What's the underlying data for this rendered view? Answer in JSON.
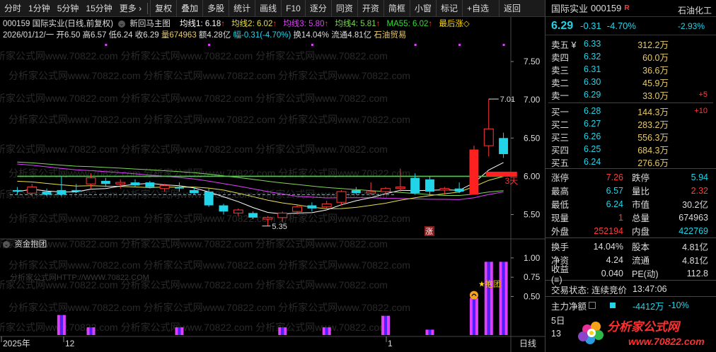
{
  "toolbar": {
    "left_items": [
      "分时",
      "1分钟",
      "5分钟",
      "15分钟",
      "更多 ›"
    ],
    "buttons": [
      "复权",
      "叠加",
      "多股",
      "统计",
      "画线",
      "F10",
      "逐分",
      "同资",
      "开资",
      "简框",
      "小窗",
      "标记",
      "+自选",
      "返回"
    ]
  },
  "chart": {
    "title": "000159 国际实业(日线,前复权)",
    "indicator_name": "新回马主图",
    "ma1_label": "均线1: 6.18",
    "ma2_label": "均线2: 6.02",
    "ma3_label": "均线3: 5.80",
    "ma4_label": "均线4: 5.81",
    "ma55_label": "MA55: 6.02",
    "last_label": "最后涨◇",
    "date_line": "2026/01/12/一",
    "open": "开6.50",
    "high": "高6.57",
    "low": "低6.24",
    "close": "收6.29",
    "vol": "量674963",
    "amount": "额4.28亿",
    "range": "幅-0.31(-4.70%)",
    "turnover": "换14.04%",
    "float": "流通4.81亿",
    "sector": "石油贸易",
    "high_mark": "7.01",
    "low_mark": "5.35",
    "days_mark": "3天",
    "zhang_mark": "涨",
    "sub_title": "资金抱团",
    "baotuan": "★抱团",
    "watermark": "分析家公式网www.70822.com",
    "watermark2": "分析家公式网HTTP://WWW.70822.COM",
    "x_labels": [
      "2025年",
      "12",
      "1"
    ],
    "x_end": "日线"
  },
  "chart_data": [
    {
      "type": "candlestick",
      "y_ticks": [
        5.5,
        6.0,
        6.5,
        7.0,
        7.5
      ],
      "ylim": [
        5.2,
        7.75
      ],
      "candles": [
        {
          "o": 5.82,
          "h": 5.86,
          "l": 5.76,
          "c": 5.8
        },
        {
          "o": 5.78,
          "h": 5.9,
          "l": 5.74,
          "c": 5.86
        },
        {
          "o": 5.8,
          "h": 5.84,
          "l": 5.74,
          "c": 5.76
        },
        {
          "o": 5.82,
          "h": 6.0,
          "l": 5.74,
          "c": 5.76
        },
        {
          "o": 5.82,
          "h": 5.9,
          "l": 5.78,
          "c": 5.8
        },
        {
          "o": 5.9,
          "h": 6.04,
          "l": 5.84,
          "c": 5.98
        },
        {
          "o": 5.94,
          "h": 5.98,
          "l": 5.86,
          "c": 5.9
        },
        {
          "o": 5.9,
          "h": 5.96,
          "l": 5.84,
          "c": 5.92
        },
        {
          "o": 5.92,
          "h": 5.96,
          "l": 5.86,
          "c": 5.88
        },
        {
          "o": 5.92,
          "h": 5.94,
          "l": 5.84,
          "c": 5.86
        },
        {
          "o": 5.84,
          "h": 5.9,
          "l": 5.8,
          "c": 5.88
        },
        {
          "o": 5.86,
          "h": 5.92,
          "l": 5.8,
          "c": 5.84
        },
        {
          "o": 5.82,
          "h": 5.86,
          "l": 5.76,
          "c": 5.78
        },
        {
          "o": 5.8,
          "h": 5.84,
          "l": 5.6,
          "c": 5.62
        },
        {
          "o": 5.62,
          "h": 5.64,
          "l": 5.5,
          "c": 5.54
        },
        {
          "o": 5.52,
          "h": 5.58,
          "l": 5.48,
          "c": 5.56
        },
        {
          "o": 5.52,
          "h": 5.54,
          "l": 5.44,
          "c": 5.46
        },
        {
          "o": 5.44,
          "h": 5.48,
          "l": 5.35,
          "c": 5.46
        },
        {
          "o": 5.46,
          "h": 5.54,
          "l": 5.4,
          "c": 5.52
        },
        {
          "o": 5.54,
          "h": 5.62,
          "l": 5.5,
          "c": 5.6
        },
        {
          "o": 5.62,
          "h": 5.66,
          "l": 5.54,
          "c": 5.58
        },
        {
          "o": 5.6,
          "h": 5.68,
          "l": 5.56,
          "c": 5.64
        },
        {
          "o": 5.66,
          "h": 5.82,
          "l": 5.62,
          "c": 5.8
        },
        {
          "o": 5.82,
          "h": 5.86,
          "l": 5.76,
          "c": 5.78
        },
        {
          "o": 5.78,
          "h": 5.92,
          "l": 5.76,
          "c": 5.8
        },
        {
          "o": 5.8,
          "h": 5.86,
          "l": 5.76,
          "c": 5.84
        },
        {
          "o": 5.84,
          "h": 6.1,
          "l": 5.8,
          "c": 5.86
        },
        {
          "o": 5.98,
          "h": 6.04,
          "l": 5.76,
          "c": 5.78
        },
        {
          "o": 5.96,
          "h": 6.0,
          "l": 5.74,
          "c": 5.8
        },
        {
          "o": 5.82,
          "h": 5.86,
          "l": 5.76,
          "c": 5.84
        },
        {
          "o": 5.84,
          "h": 5.92,
          "l": 5.78,
          "c": 5.8
        },
        {
          "o": 5.76,
          "h": 6.4,
          "l": 5.76,
          "c": 6.35
        },
        {
          "o": 6.4,
          "h": 7.01,
          "l": 6.26,
          "c": 6.62
        },
        {
          "o": 6.5,
          "h": 6.57,
          "l": 6.24,
          "c": 6.29
        }
      ]
    },
    {
      "type": "bar",
      "name": "资金抱团",
      "y_ticks": [
        0.5,
        0.75,
        1.0
      ],
      "ylim": [
        0,
        1.1
      ],
      "bars": [
        {
          "i": 3,
          "v": 0.26
        },
        {
          "i": 5,
          "v": 0.1
        },
        {
          "i": 11,
          "v": 0.1
        },
        {
          "i": 18,
          "v": 0.1
        },
        {
          "i": 21,
          "v": 0.1
        },
        {
          "i": 25,
          "v": 0.25
        },
        {
          "i": 28,
          "v": 0.07
        },
        {
          "i": 31,
          "v": 0.48
        },
        {
          "i": 32,
          "v": 0.95
        },
        {
          "i": 33,
          "v": 0.95
        }
      ]
    }
  ],
  "panel": {
    "name": "国际实业",
    "code": "000159",
    "r_tag": "R",
    "sector": "石油化工",
    "price": "6.29",
    "change": "-0.31",
    "pct": "-4.70%",
    "sector_pct": "-2.93%",
    "asks": [
      {
        "label": "卖五 ¥",
        "price": "6.33",
        "vol": "312.2万",
        "delta": ""
      },
      {
        "label": "卖四",
        "price": "6.32",
        "vol": "60.0万",
        "delta": ""
      },
      {
        "label": "卖三",
        "price": "6.31",
        "vol": "36.6万",
        "delta": ""
      },
      {
        "label": "卖二",
        "price": "6.30",
        "vol": "45.9万",
        "delta": ""
      },
      {
        "label": "卖一",
        "price": "6.29",
        "vol": "33.0万",
        "delta": "+5"
      }
    ],
    "bids": [
      {
        "label": "买一",
        "price": "6.28",
        "vol": "144.3万",
        "delta": "+10"
      },
      {
        "label": "买二",
        "price": "6.27",
        "vol": "283.2万",
        "delta": ""
      },
      {
        "label": "买三",
        "price": "6.26",
        "vol": "556.3万",
        "delta": ""
      },
      {
        "label": "买四",
        "price": "6.25",
        "vol": "684.3万",
        "delta": ""
      },
      {
        "label": "买五",
        "price": "6.24",
        "vol": "276.6万",
        "delta": ""
      }
    ],
    "stats": [
      {
        "l1": "涨停",
        "v1": "7.26",
        "c1": "red",
        "l2": "跌停",
        "v2": "5.94",
        "c2": "cyan"
      },
      {
        "l1": "最高",
        "v1": "6.57",
        "c1": "cyan",
        "l2": "量比",
        "v2": "2.32",
        "c2": "red"
      },
      {
        "l1": "最低",
        "v1": "6.24",
        "c1": "cyan",
        "l2": "市值",
        "v2": "30.2亿",
        "c2": "white"
      },
      {
        "l1": "现量",
        "v1": "1",
        "c1": "red",
        "l2": "总量",
        "v2": "674963",
        "c2": "white"
      },
      {
        "l1": "外盘",
        "v1": "252194",
        "c1": "red",
        "l2": "内盘",
        "v2": "422769",
        "c2": "cyan"
      }
    ],
    "stats2": [
      {
        "l1": "换手",
        "v1": "14.04%",
        "c1": "white",
        "l2": "股本",
        "v2": "4.81亿",
        "c2": "white"
      },
      {
        "l1": "净资",
        "v1": "4.24",
        "c1": "white",
        "l2": "流通",
        "v2": "4.81亿",
        "c2": "white"
      },
      {
        "l1": "收益(≡)",
        "v1": "0.040",
        "c1": "white",
        "l2": "PE(动)",
        "v2": "112.8",
        "c2": "white"
      }
    ],
    "trade_status_label": "交易状态: 连续竞价",
    "trade_time": "13:47:06",
    "main_flow_label": "主力净额",
    "main_flow_value": "-4412万",
    "main_flow_pct": "-10%",
    "date_short": "5日",
    "time_stub": "13",
    "logo_text": "分析家公式网",
    "logo_url": "www.70822.com"
  }
}
